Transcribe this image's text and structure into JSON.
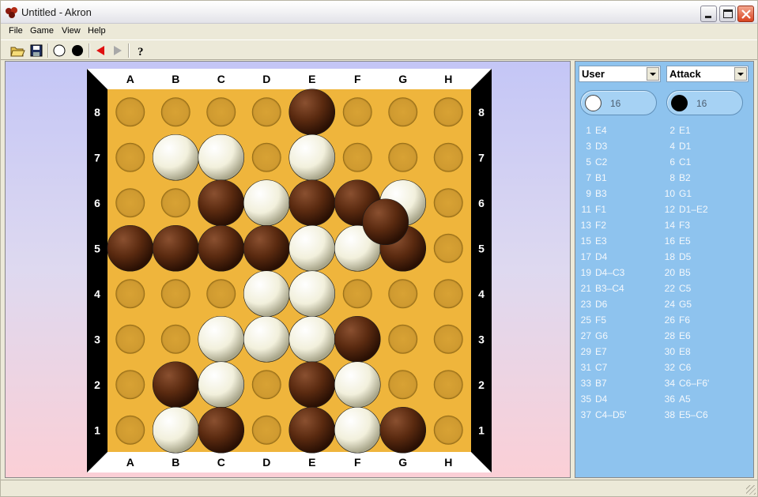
{
  "window": {
    "title": "Untitled - Akron"
  },
  "menu": [
    "File",
    "Game",
    "View",
    "Help"
  ],
  "toolbar": {
    "buttons": [
      {
        "name": "open-icon"
      },
      {
        "name": "save-icon"
      },
      {
        "name": "white-disc-icon"
      },
      {
        "name": "black-disc-icon"
      },
      {
        "name": "undo-arrow-icon"
      },
      {
        "name": "redo-arrow-icon"
      },
      {
        "name": "help-icon"
      }
    ]
  },
  "board": {
    "files": [
      "A",
      "B",
      "C",
      "D",
      "E",
      "F",
      "G",
      "H"
    ],
    "ranks": [
      "8",
      "7",
      "6",
      "5",
      "4",
      "3",
      "2",
      "1"
    ],
    "pieces": [
      {
        "cell": "E8",
        "color": "black"
      },
      {
        "cell": "B7",
        "color": "white"
      },
      {
        "cell": "C7",
        "color": "white"
      },
      {
        "cell": "E7",
        "color": "white"
      },
      {
        "cell": "C6",
        "color": "black"
      },
      {
        "cell": "D6",
        "color": "white"
      },
      {
        "cell": "E6",
        "color": "black"
      },
      {
        "cell": "F6",
        "color": "black"
      },
      {
        "cell": "G6",
        "color": "white"
      },
      {
        "cell": "A5",
        "color": "black"
      },
      {
        "cell": "B5",
        "color": "black"
      },
      {
        "cell": "C5",
        "color": "black"
      },
      {
        "cell": "D5",
        "color": "black"
      },
      {
        "cell": "E5",
        "color": "white"
      },
      {
        "cell": "F5",
        "color": "white"
      },
      {
        "cell": "G5",
        "color": "black"
      },
      {
        "cell": "D4",
        "color": "white"
      },
      {
        "cell": "E4",
        "color": "white"
      },
      {
        "cell": "C3",
        "color": "white"
      },
      {
        "cell": "D3",
        "color": "white"
      },
      {
        "cell": "E3",
        "color": "white"
      },
      {
        "cell": "F3",
        "color": "black"
      },
      {
        "cell": "B2",
        "color": "black"
      },
      {
        "cell": "C2",
        "color": "white"
      },
      {
        "cell": "E2",
        "color": "black"
      },
      {
        "cell": "F2",
        "color": "white"
      },
      {
        "cell": "B1",
        "color": "white"
      },
      {
        "cell": "C1",
        "color": "black"
      },
      {
        "cell": "E1",
        "color": "black"
      },
      {
        "cell": "F1",
        "color": "white"
      },
      {
        "cell": "G1",
        "color": "black"
      }
    ],
    "stacked": [
      {
        "cell": "G6",
        "color": "black"
      }
    ],
    "colors": {
      "board": "#efb53c",
      "frame": "#000000",
      "white": "#f2f0dc",
      "black": "#5a2a10"
    }
  },
  "side": {
    "player_white": "User",
    "player_black": "Attack",
    "score_white": "16",
    "score_black": "16",
    "moves": [
      {
        "n": "1",
        "m": "E4"
      },
      {
        "n": "2",
        "m": "E1"
      },
      {
        "n": "3",
        "m": "D3"
      },
      {
        "n": "4",
        "m": "D1"
      },
      {
        "n": "5",
        "m": "C2"
      },
      {
        "n": "6",
        "m": "C1"
      },
      {
        "n": "7",
        "m": "B1"
      },
      {
        "n": "8",
        "m": "B2"
      },
      {
        "n": "9",
        "m": "B3"
      },
      {
        "n": "10",
        "m": "G1"
      },
      {
        "n": "11",
        "m": "F1"
      },
      {
        "n": "12",
        "m": "D1–E2"
      },
      {
        "n": "13",
        "m": "F2"
      },
      {
        "n": "14",
        "m": "F3"
      },
      {
        "n": "15",
        "m": "E3"
      },
      {
        "n": "16",
        "m": "E5"
      },
      {
        "n": "17",
        "m": "D4"
      },
      {
        "n": "18",
        "m": "D5"
      },
      {
        "n": "19",
        "m": "D4–C3"
      },
      {
        "n": "20",
        "m": "B5"
      },
      {
        "n": "21",
        "m": "B3–C4"
      },
      {
        "n": "22",
        "m": "C5"
      },
      {
        "n": "23",
        "m": "D6"
      },
      {
        "n": "24",
        "m": "G5"
      },
      {
        "n": "25",
        "m": "F5"
      },
      {
        "n": "26",
        "m": "F6"
      },
      {
        "n": "27",
        "m": "G6"
      },
      {
        "n": "28",
        "m": "E6"
      },
      {
        "n": "29",
        "m": "E7"
      },
      {
        "n": "30",
        "m": "E8"
      },
      {
        "n": "31",
        "m": "C7"
      },
      {
        "n": "32",
        "m": "C6"
      },
      {
        "n": "33",
        "m": "B7"
      },
      {
        "n": "34",
        "m": "C6–F6'"
      },
      {
        "n": "35",
        "m": "D4"
      },
      {
        "n": "36",
        "m": "A5"
      },
      {
        "n": "37",
        "m": "C4–D5'"
      },
      {
        "n": "38",
        "m": "E5–C6"
      }
    ]
  }
}
